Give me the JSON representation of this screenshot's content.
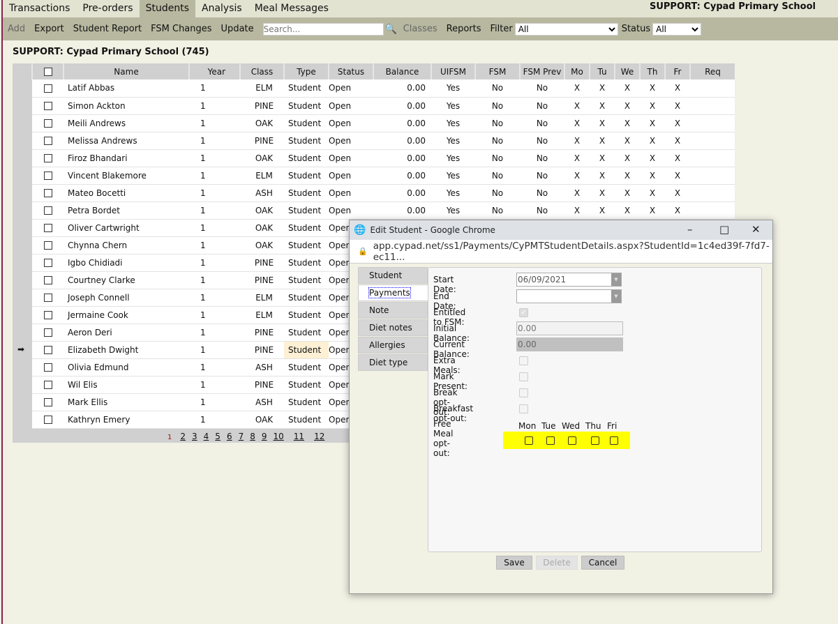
{
  "nav": {
    "tabs": [
      "Transactions",
      "Pre-orders",
      "Students",
      "Analysis",
      "Meal Messages"
    ],
    "active": "Students",
    "school": "SUPPORT: Cypad Primary School"
  },
  "toolbar": {
    "add": "Add",
    "export": "Export",
    "student_report": "Student Report",
    "fsm_changes": "FSM Changes",
    "update": "Update",
    "search_placeholder": "Search...",
    "classes": "Classes",
    "reports": "Reports",
    "filter_label": "Filter",
    "filter_value": "All",
    "status_label": "Status",
    "status_value": "All"
  },
  "title": "SUPPORT: Cypad Primary School (745)",
  "table": {
    "headers": [
      "",
      "Name",
      "Year",
      "Class",
      "Type",
      "Status",
      "Balance",
      "UIFSM",
      "FSM",
      "FSM Prev",
      "Mo",
      "Tu",
      "We",
      "Th",
      "Fr",
      "Req"
    ],
    "rows": [
      [
        "Latif Abbas",
        "1",
        "ELM",
        "Student",
        "Open",
        "0.00",
        "Yes",
        "No",
        "No",
        "X",
        "X",
        "X",
        "X",
        "X",
        ""
      ],
      [
        "Simon Ackton",
        "1",
        "PINE",
        "Student",
        "Open",
        "0.00",
        "Yes",
        "No",
        "No",
        "X",
        "X",
        "X",
        "X",
        "X",
        ""
      ],
      [
        "Meili Andrews",
        "1",
        "OAK",
        "Student",
        "Open",
        "0.00",
        "Yes",
        "No",
        "No",
        "X",
        "X",
        "X",
        "X",
        "X",
        ""
      ],
      [
        "Melissa Andrews",
        "1",
        "PINE",
        "Student",
        "Open",
        "0.00",
        "Yes",
        "No",
        "No",
        "X",
        "X",
        "X",
        "X",
        "X",
        ""
      ],
      [
        "Firoz Bhandari",
        "1",
        "OAK",
        "Student",
        "Open",
        "0.00",
        "Yes",
        "No",
        "No",
        "X",
        "X",
        "X",
        "X",
        "X",
        ""
      ],
      [
        "Vincent Blakemore",
        "1",
        "ELM",
        "Student",
        "Open",
        "0.00",
        "Yes",
        "No",
        "No",
        "X",
        "X",
        "X",
        "X",
        "X",
        ""
      ],
      [
        "Mateo Bocetti",
        "1",
        "ASH",
        "Student",
        "Open",
        "0.00",
        "Yes",
        "No",
        "No",
        "X",
        "X",
        "X",
        "X",
        "X",
        ""
      ],
      [
        "Petra Bordet",
        "1",
        "OAK",
        "Student",
        "Open",
        "0.00",
        "Yes",
        "No",
        "No",
        "X",
        "X",
        "X",
        "X",
        "X",
        ""
      ],
      [
        "Oliver Cartwright",
        "1",
        "OAK",
        "Student",
        "Open"
      ],
      [
        "Chynna Chern",
        "1",
        "OAK",
        "Student",
        "Open"
      ],
      [
        "Igbo Chidiadi",
        "1",
        "PINE",
        "Student",
        "Open"
      ],
      [
        "Courtney Clarke",
        "1",
        "PINE",
        "Student",
        "Open"
      ],
      [
        "Joseph Connell",
        "1",
        "ELM",
        "Student",
        "Open"
      ],
      [
        "Jermaine Cook",
        "1",
        "ELM",
        "Student",
        "Open"
      ],
      [
        "Aeron Deri",
        "1",
        "PINE",
        "Student",
        "Open"
      ],
      [
        "Elizabeth Dwight",
        "1",
        "PINE",
        "Student",
        "Open"
      ],
      [
        "Olivia Edmund",
        "1",
        "ASH",
        "Student",
        "Open"
      ],
      [
        "Wil Elis",
        "1",
        "PINE",
        "Student",
        "Open"
      ],
      [
        "Mark Ellis",
        "1",
        "ASH",
        "Student",
        "Open"
      ],
      [
        "Kathryn Emery",
        "1",
        "OAK",
        "Student",
        "Open"
      ]
    ],
    "selected_index": 15
  },
  "pager": {
    "current": "1",
    "pages": [
      "2",
      "3",
      "4",
      "5",
      "6",
      "7",
      "8",
      "9",
      "10",
      "11",
      "12"
    ]
  },
  "dialog": {
    "title": "Edit Student - Google Chrome",
    "url": "app.cypad.net/ss1/Payments/CyPMTStudentDetails.aspx?StudentId=1c4ed39f-7fd7-ec11...",
    "tabs": [
      "Student",
      "Payments",
      "Note",
      "Diet notes",
      "Allergies",
      "Diet type"
    ],
    "active_tab": "Payments",
    "start_date_label": "Start Date:",
    "start_date": "06/09/2021",
    "end_date_label": "End Date:",
    "end_date": "",
    "entitled_label": "Entitled to FSM:",
    "entitled_checked": true,
    "initial_balance_label": "Initial Balance:",
    "initial_balance": "0.00",
    "current_balance_label": "Current Balance:",
    "current_balance": "0.00",
    "extra_meals_label": "Extra Meals:",
    "mark_present_label": "Mark Present:",
    "break_label": "Break opt-out:",
    "breakfast_label": "Breakfast opt-out:",
    "free_meal_label": "Free Meal opt-out:",
    "days": [
      "Mon",
      "Tue",
      "Wed",
      "Thu",
      "Fri"
    ],
    "highlight_color": "#ffff00",
    "save": "Save",
    "delete": "Delete",
    "cancel": "Cancel"
  }
}
